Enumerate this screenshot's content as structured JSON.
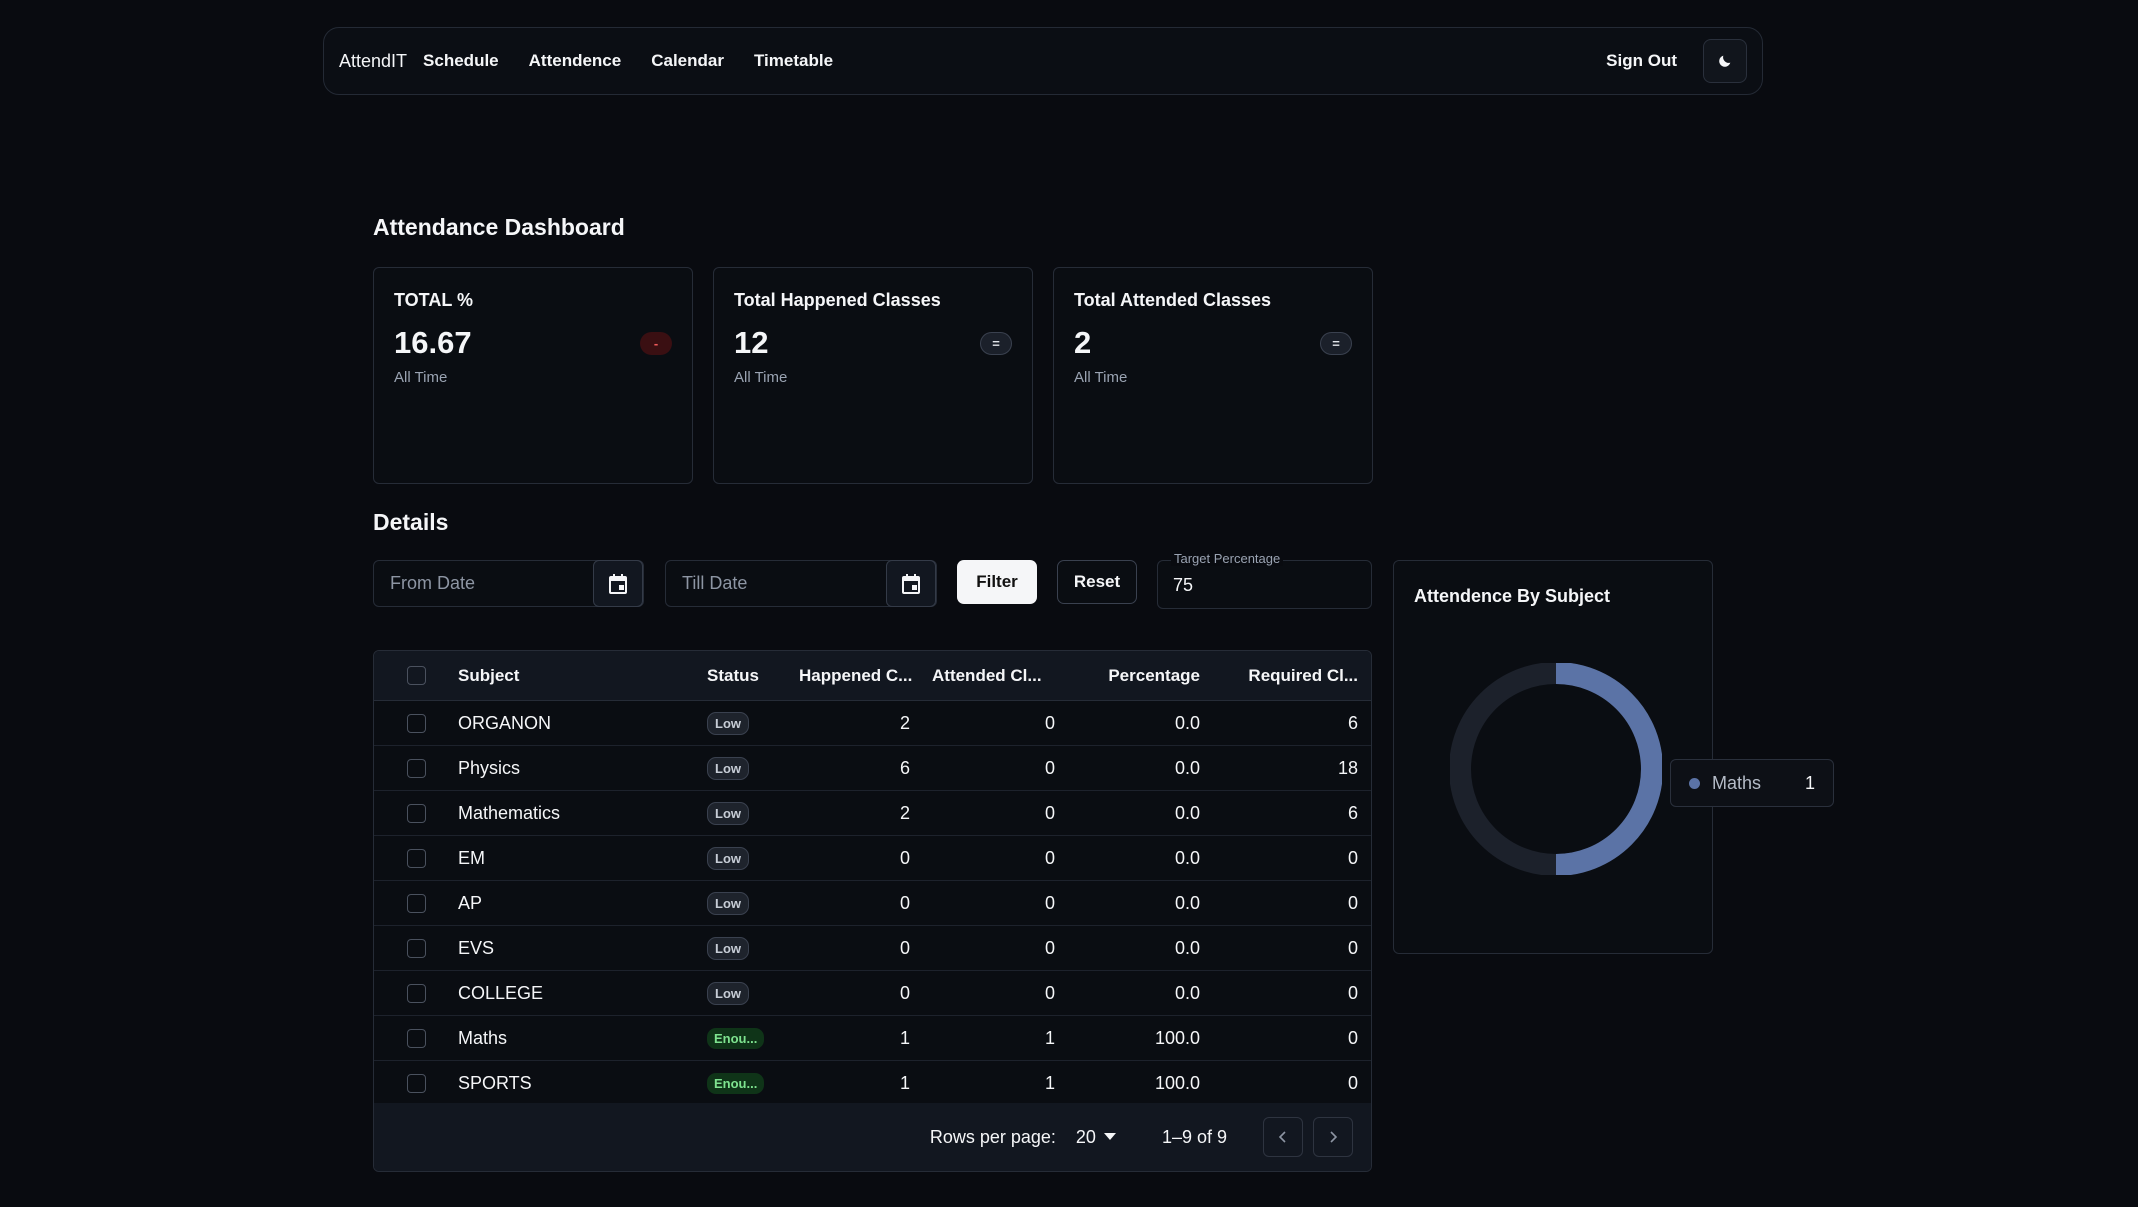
{
  "nav": {
    "brand": "AttendIT",
    "links": [
      "Schedule",
      "Attendence",
      "Calendar",
      "Timetable"
    ],
    "sign_out": "Sign Out",
    "theme_icon": "moon-icon"
  },
  "page_title": "Attendance Dashboard",
  "stats": [
    {
      "title": "TOTAL %",
      "value": "16.67",
      "sub": "All Time",
      "badge": "-",
      "badge_color": "#f05a5a"
    },
    {
      "title": "Total Happened Classes",
      "value": "12",
      "sub": "All Time",
      "badge": "="
    },
    {
      "title": "Total Attended Classes",
      "value": "2",
      "sub": "All Time",
      "badge": "="
    }
  ],
  "details_title": "Details",
  "filters": {
    "from_placeholder": "From Date",
    "till_placeholder": "Till Date",
    "filter_label": "Filter",
    "reset_label": "Reset",
    "target_label": "Target Percentage",
    "target_value": "75"
  },
  "table": {
    "headers": [
      "Subject",
      "Status",
      "Happened C...",
      "Attended Cl...",
      "Percentage",
      "Required Cl..."
    ],
    "rows": [
      {
        "subject": "ORGANON",
        "status": "Low",
        "happened": "2",
        "attended": "0",
        "percentage": "0.0",
        "required": "6"
      },
      {
        "subject": "Physics",
        "status": "Low",
        "happened": "6",
        "attended": "0",
        "percentage": "0.0",
        "required": "18"
      },
      {
        "subject": "Mathematics",
        "status": "Low",
        "happened": "2",
        "attended": "0",
        "percentage": "0.0",
        "required": "6"
      },
      {
        "subject": "EM",
        "status": "Low",
        "happened": "0",
        "attended": "0",
        "percentage": "0.0",
        "required": "0"
      },
      {
        "subject": "AP",
        "status": "Low",
        "happened": "0",
        "attended": "0",
        "percentage": "0.0",
        "required": "0"
      },
      {
        "subject": "EVS",
        "status": "Low",
        "happened": "0",
        "attended": "0",
        "percentage": "0.0",
        "required": "0"
      },
      {
        "subject": "COLLEGE",
        "status": "Low",
        "happened": "0",
        "attended": "0",
        "percentage": "0.0",
        "required": "0"
      },
      {
        "subject": "Maths",
        "status": "Enou...",
        "happened": "1",
        "attended": "1",
        "percentage": "100.0",
        "required": "0"
      },
      {
        "subject": "SPORTS",
        "status": "Enou...",
        "happened": "1",
        "attended": "1",
        "percentage": "100.0",
        "required": "0"
      }
    ],
    "footer": {
      "rows_per_page_label": "Rows per page:",
      "rows_per_page_value": "20",
      "range": "1–9 of 9"
    }
  },
  "chart": {
    "title": "Attendence By Subject",
    "colors": {
      "filled": "#5b73a6",
      "track": "#1c212b"
    },
    "legend": {
      "name": "Maths",
      "value": "1"
    }
  },
  "chart_data": {
    "type": "pie",
    "title": "Attendence By Subject",
    "categories": [
      "Maths"
    ],
    "values": [
      1
    ],
    "shown_fraction": 0.5
  }
}
